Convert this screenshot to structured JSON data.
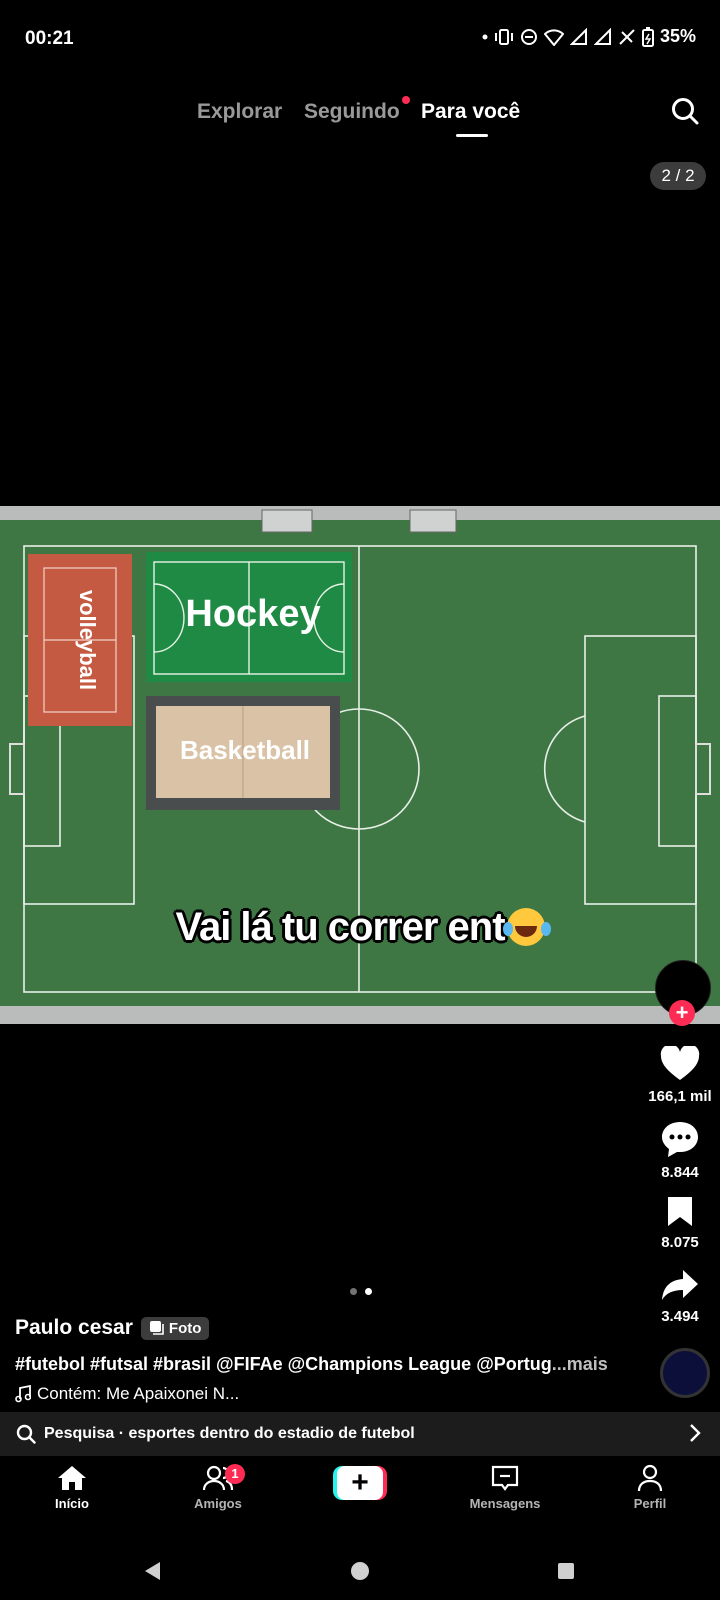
{
  "status_bar": {
    "time": "00:21",
    "battery": "35%"
  },
  "top_nav": {
    "tabs": [
      "Explorar",
      "Seguindo",
      "Para você"
    ],
    "active": "Para você"
  },
  "photo_counter": "2 / 2",
  "post_image": {
    "labels": {
      "volleyball": "volleyball",
      "hockey": "Hockey",
      "basketball": "Basketball"
    },
    "caption_text": "Vai lá tu correr ent"
  },
  "actions": {
    "likes": "166,1 mil",
    "comments": "8.844",
    "saves": "8.075",
    "shares": "3.494"
  },
  "post": {
    "author": "Paulo cesar",
    "type_badge": "Foto",
    "description": "#futebol #futsal #brasil @FIFAe @Champions League @Portug",
    "more": "...mais",
    "sound": "Contém: Me Apaixonei N..."
  },
  "search_suggestion": "Pesquisa · esportes dentro do estadio de futebol",
  "bottom_tabs": {
    "inicio": "Início",
    "amigos": "Amigos",
    "amigos_badge": "1",
    "mensagens": "Mensagens",
    "perfil": "Perfil"
  },
  "colors": {
    "accent": "#fe2c55",
    "accent2": "#25f4ee",
    "pitch": "#3f7a45"
  },
  "icons": [
    "search-icon",
    "heart-icon",
    "comment-icon",
    "bookmark-icon",
    "share-icon",
    "home-icon",
    "friends-icon",
    "plus-icon",
    "inbox-icon",
    "profile-icon",
    "music-note-icon",
    "chevron-right-icon",
    "back-icon",
    "home-circle-icon",
    "recents-icon"
  ]
}
